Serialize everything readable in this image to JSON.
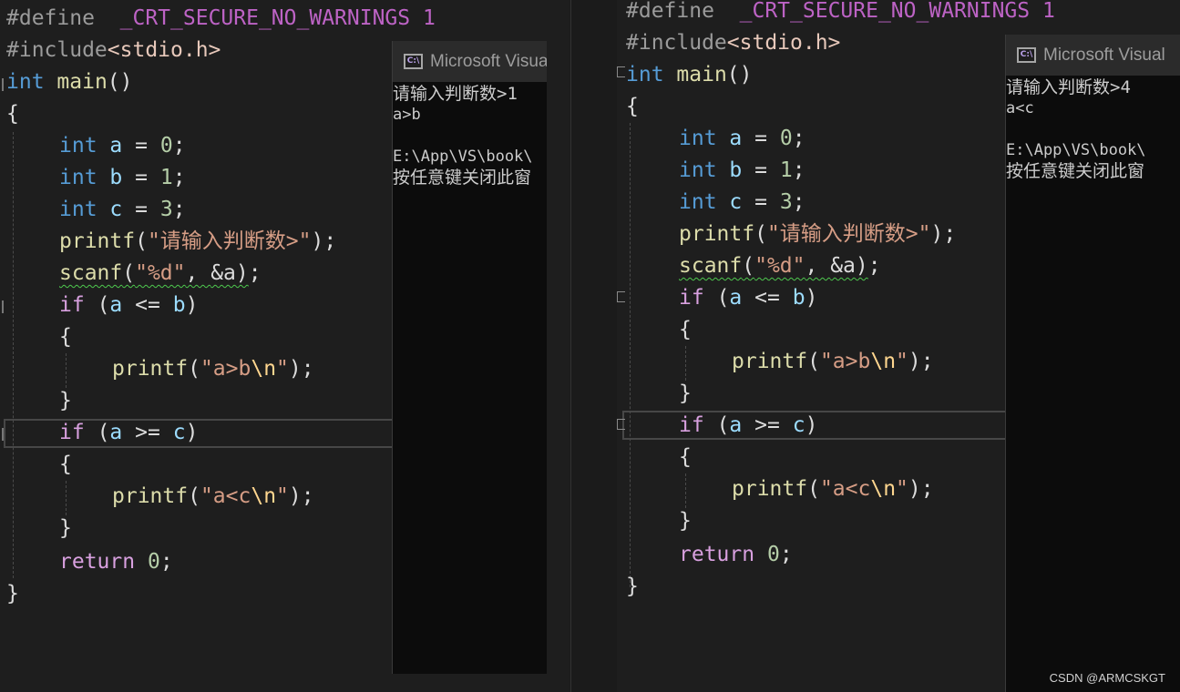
{
  "editors": [
    {
      "code": {
        "define_kw": "#define",
        "define_macro": "_CRT_SECURE_NO_WARNINGS",
        "define_value": "1",
        "include_kw": "#include",
        "include_header": "<stdio.h>",
        "main_type": "int",
        "main_name": "main",
        "main_parens": "()",
        "open_brace": "{",
        "close_brace": "}",
        "int_kw": "int",
        "var_a": "a",
        "var_b": "b",
        "var_c": "c",
        "assign": "=",
        "val_a": "0",
        "val_b": "1",
        "val_c": "3",
        "semicolon": ";",
        "printf_fn": "printf",
        "scanf_fn": "scanf",
        "prompt_string": "\"请输入判断数>\"",
        "format_string": "\"%d\"",
        "scanf_args": "&a",
        "if_kw": "if",
        "cond1_op": "<=",
        "cond2_op": ">=",
        "msg1_text": "\"a>b",
        "msg2_text": "\"a<c",
        "newline_escape": "\\n",
        "quote": "\"",
        "return_kw": "return",
        "return_val": "0"
      },
      "console": {
        "title": "Microsoft Visual",
        "icon_label": "C:\\",
        "lines": [
          "请输入判断数>1",
          "a>b",
          "",
          "E:\\App\\VS\\book\\",
          "按任意键关闭此窗"
        ]
      }
    },
    {
      "code": {
        "define_kw": "#define",
        "define_macro": "_CRT_SECURE_NO_WARNINGS",
        "define_value": "1",
        "include_kw": "#include",
        "include_header": "<stdio.h>",
        "main_type": "int",
        "main_name": "main",
        "main_parens": "()",
        "open_brace": "{",
        "close_brace": "}",
        "int_kw": "int",
        "var_a": "a",
        "var_b": "b",
        "var_c": "c",
        "assign": "=",
        "val_a": "0",
        "val_b": "1",
        "val_c": "3",
        "semicolon": ";",
        "printf_fn": "printf",
        "scanf_fn": "scanf",
        "prompt_string": "\"请输入判断数>\"",
        "format_string": "\"%d\"",
        "scanf_args": "&a",
        "if_kw": "if",
        "cond1_op": "<=",
        "cond2_op": ">=",
        "msg1_text": "\"a>b",
        "msg2_text": "\"a<c",
        "newline_escape": "\\n",
        "quote": "\"",
        "return_kw": "return",
        "return_val": "0"
      },
      "console": {
        "title": "Microsoft Visual",
        "icon_label": "C:\\",
        "lines": [
          "请输入判断数>4",
          "a<c",
          "",
          "E:\\App\\VS\\book\\",
          "按任意键关闭此窗"
        ]
      }
    }
  ],
  "watermark": "CSDN @ARMCSKGT",
  "colors": {
    "background": "#1e1e1e",
    "keyword": "#569cd6",
    "control_keyword": "#d8a0df",
    "function": "#dcdcaa",
    "variable": "#9cdcfe",
    "string": "#d69d85",
    "macro": "#bd63c5",
    "console_background": "#0c0c0c"
  }
}
